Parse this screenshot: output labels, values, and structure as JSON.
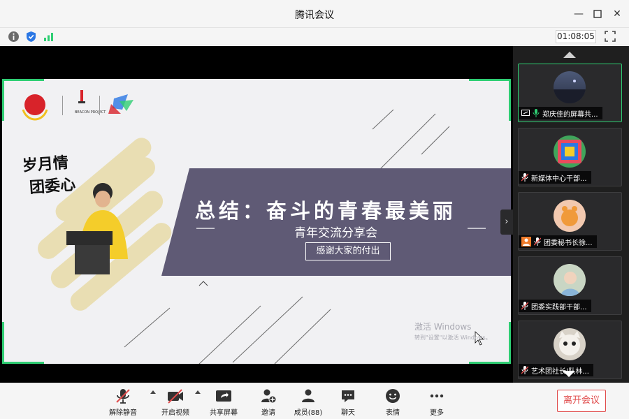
{
  "window": {
    "title": "腾讯会议"
  },
  "status": {
    "timer": "01:08:05"
  },
  "slide": {
    "title": "总结：奋斗的青春最美丽",
    "subtitle": "青年交流分享会",
    "button": "感谢大家的付出",
    "handwriting_line1": "岁月情",
    "handwriting_line2": "团委心",
    "beacon_label": "BEACON PROJECT",
    "watermark_line1": "激活 Windows",
    "watermark_line2": "转到\"设置\"以激活 Windows。"
  },
  "participants": [
    {
      "label": "郑庆佳的屏幕共..."
    },
    {
      "label": "新媒体中心干部..."
    },
    {
      "label": "团委秘书长徐..."
    },
    {
      "label": "团委实践部干部..."
    },
    {
      "label": "艺术团社长|队林..."
    }
  ],
  "toolbar": {
    "mute": "解除静音",
    "video": "开启视频",
    "share": "共享屏幕",
    "invite": "邀请",
    "members": "成员(88)",
    "chat": "聊天",
    "emoji": "表情",
    "more": "更多",
    "leave": "离开会议"
  },
  "colors": {
    "accent_green": "#2fce73",
    "leave_red": "#e04a4a",
    "banner": "#5f5a75"
  },
  "icons": [
    "info-icon",
    "shield-icon",
    "signal-icon",
    "fullscreen-icon",
    "mic-muted-icon",
    "video-off-icon",
    "share-screen-icon",
    "add-user-icon",
    "members-icon",
    "chat-icon",
    "emoji-icon",
    "more-icon"
  ]
}
